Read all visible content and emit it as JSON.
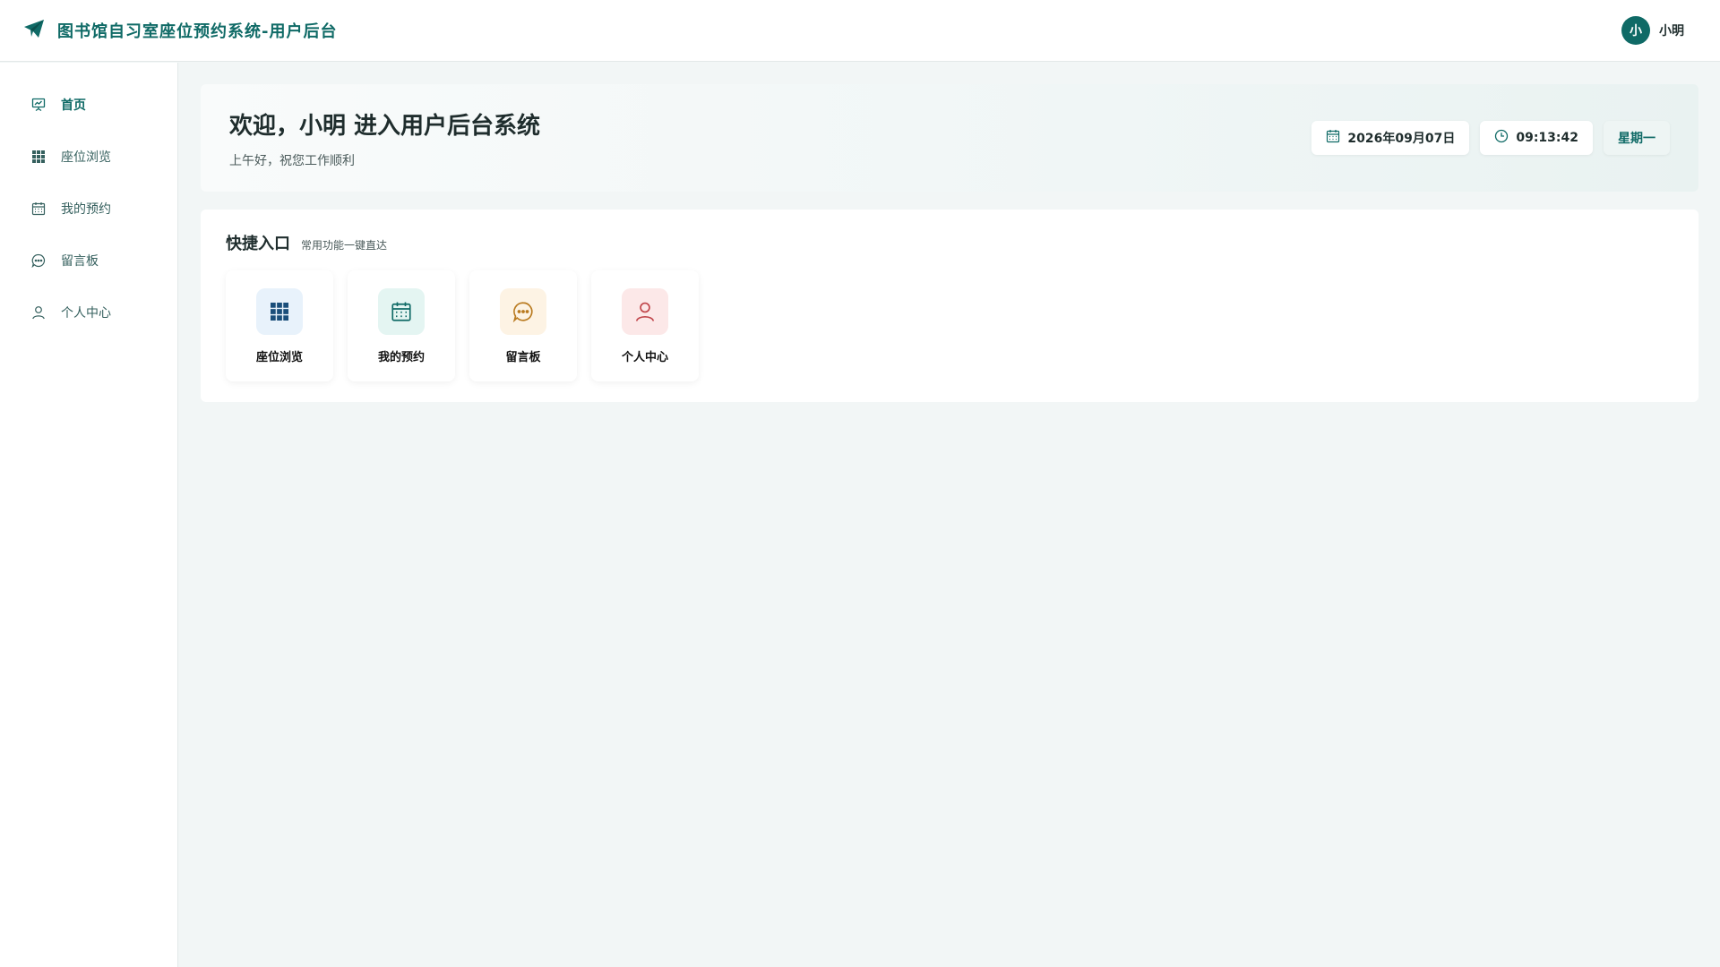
{
  "header": {
    "title": "图书馆自习室座位预约系统-用户后台",
    "logo_icon": "paper-plane-icon",
    "user": {
      "avatar_text": "小",
      "name": "小明"
    }
  },
  "sidebar": {
    "items": [
      {
        "label": "首页",
        "icon": "presentation-icon",
        "active": true
      },
      {
        "label": "座位浏览",
        "icon": "grid-icon",
        "active": false
      },
      {
        "label": "我的预约",
        "icon": "calendar-icon",
        "active": false
      },
      {
        "label": "留言板",
        "icon": "chat-bubble-icon",
        "active": false
      },
      {
        "label": "个人中心",
        "icon": "user-icon",
        "active": false
      }
    ]
  },
  "welcome": {
    "title": "欢迎，小明 进入用户后台系统",
    "subtitle": "上午好，祝您工作顺利",
    "date": "2026年09月07日",
    "time": "09:13:42",
    "weekday": "星期一"
  },
  "quick": {
    "title": "快捷入口",
    "subtitle": "常用功能一键直达",
    "cards": [
      {
        "label": "座位浏览",
        "icon": "grid-icon",
        "bg": "#e8f2fb",
        "color": "#1a4e7a"
      },
      {
        "label": "我的预约",
        "icon": "calendar-icon",
        "bg": "#e4f5f2",
        "color": "#0f6a66"
      },
      {
        "label": "留言板",
        "icon": "chat-bubble-icon",
        "bg": "#fdf3e4",
        "color": "#b97a1f"
      },
      {
        "label": "个人中心",
        "icon": "user-icon",
        "bg": "#fce8e8",
        "color": "#c0454a"
      }
    ]
  },
  "colors": {
    "brand": "#0f6a66",
    "background": "#f2f6f6"
  }
}
